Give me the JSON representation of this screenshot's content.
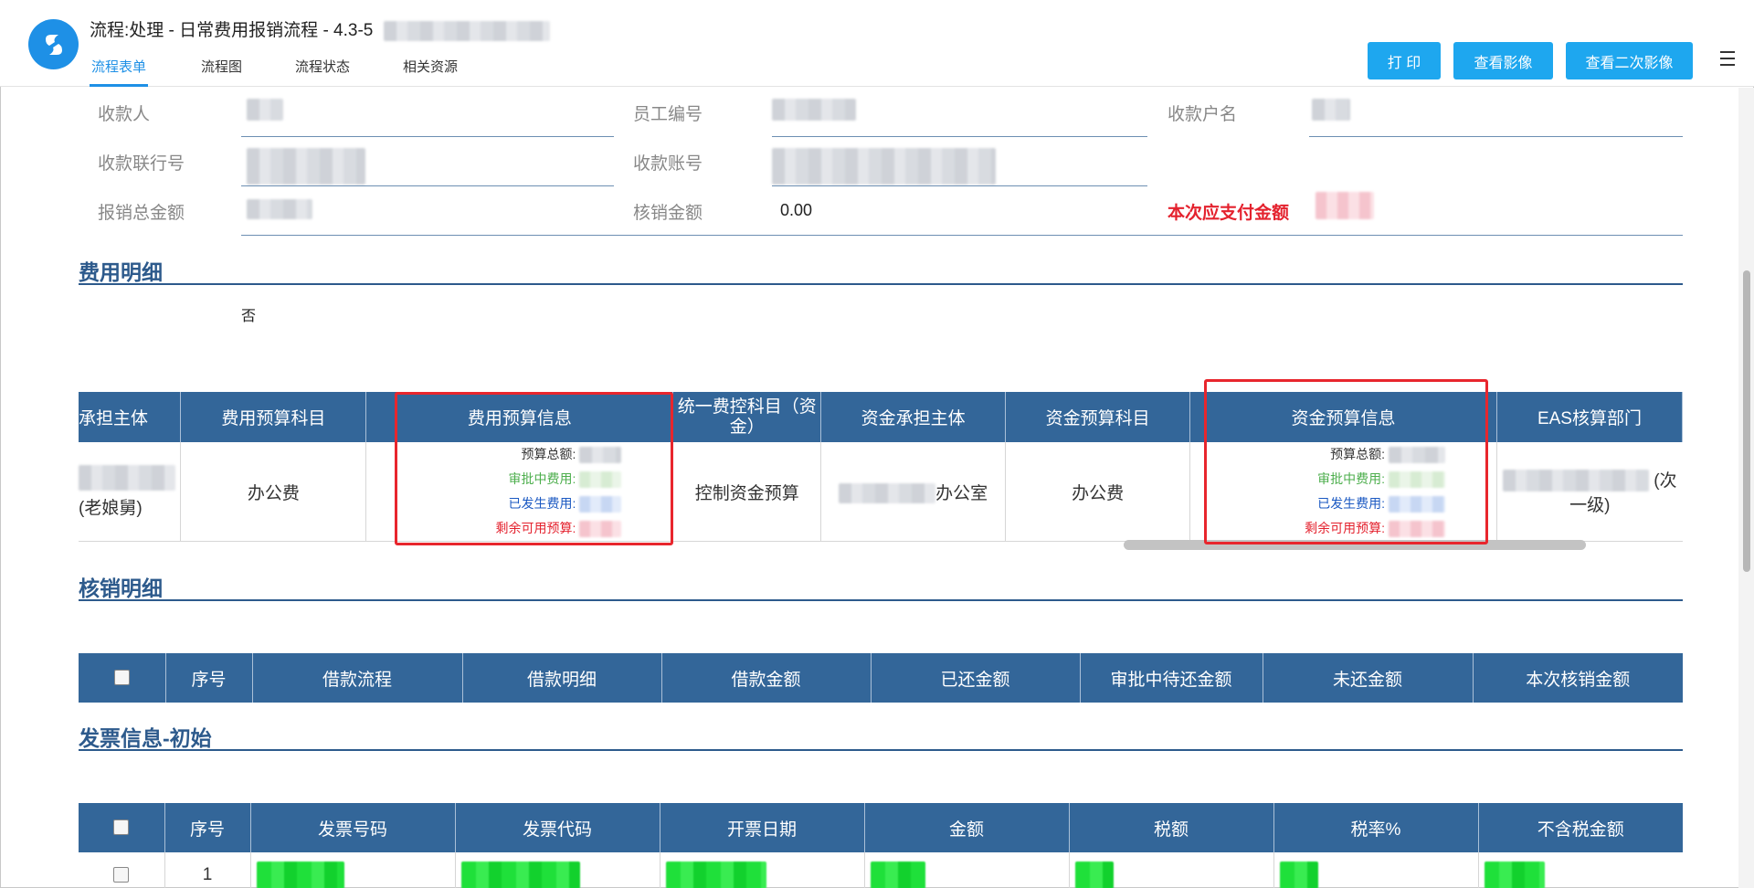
{
  "header": {
    "title": "流程:处理 - 日常费用报销流程 - 4.3-5",
    "tabs": [
      "流程表单",
      "流程图",
      "流程状态",
      "相关资源"
    ],
    "buttons": {
      "print": "打 印",
      "view_image": "查看影像",
      "view_second_image": "查看二次影像"
    }
  },
  "form": {
    "payee_label": "收款人",
    "employee_no_label": "员工编号",
    "account_name_label": "收款户名",
    "bank_no_label": "收款联行号",
    "account_no_label": "收款账号",
    "total_label": "报销总金额",
    "writeoff_label": "核销金额",
    "writeoff_value": "0.00",
    "payable_label": "本次应支付金额"
  },
  "expense_section": {
    "title": "费用明细",
    "flag_value": "否",
    "headers": [
      "承担主体",
      "费用预算科目",
      "费用预算信息",
      "统一费控科目（资金）",
      "资金承担主体",
      "资金预算科目",
      "资金预算信息",
      "EAS核算部门"
    ],
    "row": {
      "entity_suffix": "(老娘舅)",
      "budget_subject": "办公费",
      "control_subject": "控制资金预算",
      "fund_entity_suffix": "办公室",
      "fund_budget_subject": "办公费",
      "eas_dept_suffix_1": "(次",
      "eas_dept_suffix_2": "一级)"
    },
    "budget_labels": {
      "total": "预算总额:",
      "pending": "审批中费用:",
      "incurred": "已发生费用:",
      "remaining": "剩余可用预算:"
    }
  },
  "writeoff_section": {
    "title": "核销明细",
    "headers": [
      "序号",
      "借款流程",
      "借款明细",
      "借款金额",
      "已还金额",
      "审批中待还金额",
      "未还金额",
      "本次核销金额"
    ]
  },
  "invoice_section": {
    "title": "发票信息-初始",
    "headers": [
      "序号",
      "发票号码",
      "发票代码",
      "开票日期",
      "金额",
      "税额",
      "税率%",
      "不含税金额"
    ],
    "rows": [
      {
        "no": "1"
      }
    ]
  }
}
